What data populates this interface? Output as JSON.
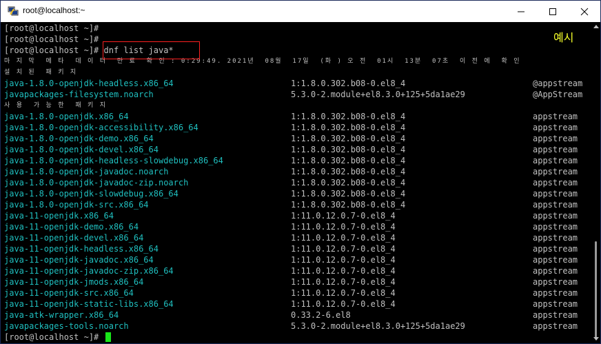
{
  "window": {
    "title": "root@localhost:~",
    "buttons": {
      "minimize": "minimize",
      "maximize": "maximize",
      "close": "close"
    }
  },
  "annotation": "예시",
  "colors": {
    "name_text": "#1fbfbf",
    "default_text": "#c0c0c0",
    "highlight_box": "#ff2020",
    "annotation": "#f5ff2a",
    "cursor": "#19e619"
  },
  "terminal": {
    "prompt_lines": [
      "[root@localhost ~]#",
      "[root@localhost ~]#"
    ],
    "command_prompt": "[root@localhost ~]# ",
    "command": "dnf list java*",
    "metadata_line": "마 지 막  메 타  데 이 터  만 료  확 인 : 0:29:49. 2021년  08월  17일  (화 ) 오 전  01시  13분  07초  이 전 에  확 인",
    "installed_header": "설 치 된  패 키 지",
    "installed": [
      {
        "name": "java-1.8.0-openjdk-headless.x86_64",
        "version": "1:1.8.0.302.b08-0.el8_4",
        "repo": "@appstream"
      },
      {
        "name": "javapackages-filesystem.noarch",
        "version": "5.3.0-2.module+el8.3.0+125+5da1ae29",
        "repo": "@AppStream"
      }
    ],
    "available_header": "사 용  가 능 한  패 키 지",
    "available": [
      {
        "name": "java-1.8.0-openjdk.x86_64",
        "version": "1:1.8.0.302.b08-0.el8_4",
        "repo": "appstream"
      },
      {
        "name": "java-1.8.0-openjdk-accessibility.x86_64",
        "version": "1:1.8.0.302.b08-0.el8_4",
        "repo": "appstream"
      },
      {
        "name": "java-1.8.0-openjdk-demo.x86_64",
        "version": "1:1.8.0.302.b08-0.el8_4",
        "repo": "appstream"
      },
      {
        "name": "java-1.8.0-openjdk-devel.x86_64",
        "version": "1:1.8.0.302.b08-0.el8_4",
        "repo": "appstream"
      },
      {
        "name": "java-1.8.0-openjdk-headless-slowdebug.x86_64",
        "version": "1:1.8.0.302.b08-0.el8_4",
        "repo": "appstream"
      },
      {
        "name": "java-1.8.0-openjdk-javadoc.noarch",
        "version": "1:1.8.0.302.b08-0.el8_4",
        "repo": "appstream"
      },
      {
        "name": "java-1.8.0-openjdk-javadoc-zip.noarch",
        "version": "1:1.8.0.302.b08-0.el8_4",
        "repo": "appstream"
      },
      {
        "name": "java-1.8.0-openjdk-slowdebug.x86_64",
        "version": "1:1.8.0.302.b08-0.el8_4",
        "repo": "appstream"
      },
      {
        "name": "java-1.8.0-openjdk-src.x86_64",
        "version": "1:1.8.0.302.b08-0.el8_4",
        "repo": "appstream"
      },
      {
        "name": "java-11-openjdk.x86_64",
        "version": "1:11.0.12.0.7-0.el8_4",
        "repo": "appstream"
      },
      {
        "name": "java-11-openjdk-demo.x86_64",
        "version": "1:11.0.12.0.7-0.el8_4",
        "repo": "appstream"
      },
      {
        "name": "java-11-openjdk-devel.x86_64",
        "version": "1:11.0.12.0.7-0.el8_4",
        "repo": "appstream"
      },
      {
        "name": "java-11-openjdk-headless.x86_64",
        "version": "1:11.0.12.0.7-0.el8_4",
        "repo": "appstream"
      },
      {
        "name": "java-11-openjdk-javadoc.x86_64",
        "version": "1:11.0.12.0.7-0.el8_4",
        "repo": "appstream"
      },
      {
        "name": "java-11-openjdk-javadoc-zip.x86_64",
        "version": "1:11.0.12.0.7-0.el8_4",
        "repo": "appstream"
      },
      {
        "name": "java-11-openjdk-jmods.x86_64",
        "version": "1:11.0.12.0.7-0.el8_4",
        "repo": "appstream"
      },
      {
        "name": "java-11-openjdk-src.x86_64",
        "version": "1:11.0.12.0.7-0.el8_4",
        "repo": "appstream"
      },
      {
        "name": "java-11-openjdk-static-libs.x86_64",
        "version": "1:11.0.12.0.7-0.el8_4",
        "repo": "appstream"
      },
      {
        "name": "java-atk-wrapper.x86_64",
        "version": "0.33.2-6.el8",
        "repo": "appstream"
      },
      {
        "name": "javapackages-tools.noarch",
        "version": "5.3.0-2.module+el8.3.0+125+5da1ae29",
        "repo": "appstream"
      }
    ],
    "final_prompt": "[root@localhost ~]# "
  }
}
